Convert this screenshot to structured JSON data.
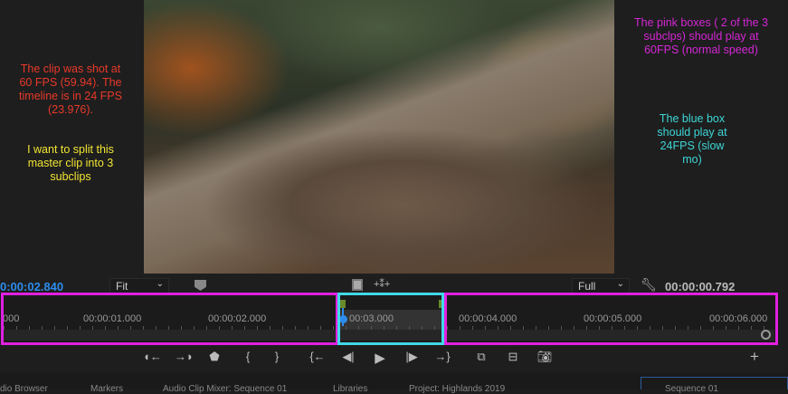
{
  "annotations": {
    "left_red": "The clip was shot at 60 FPS (59.94). The timeline is in 24 FPS (23.976).",
    "left_yellow": "I want to split this master clip into 3 subclips",
    "right_pink": "The pink boxes ( 2 of the 3 subclps) should play at 60FPS (normal speed)",
    "right_cyan": "The blue box should play at 24FPS (slow mo)"
  },
  "monitor": {
    "current_timecode": "0:00:02.840",
    "zoom_select": "Fit",
    "resolution_select": "Full",
    "duration_timecode": "00:00:00.792"
  },
  "ruler": {
    "ticks": [
      "000",
      "00:00:01.000",
      "00:00:02.000",
      "00:03.000",
      "00:00:04.000",
      "00:00:05.000",
      "00:00:06.000"
    ]
  },
  "colors": {
    "pink": "#e020e0",
    "cyan": "#40d8e8",
    "playhead": "#2d8ceb"
  },
  "controls": {
    "add": "+"
  },
  "tabs": [
    "dio Browser",
    "Markers",
    "Audio Clip Mixer: Sequence 01",
    "Libraries",
    "Project: Highlands 2019",
    "Sequence 01"
  ]
}
